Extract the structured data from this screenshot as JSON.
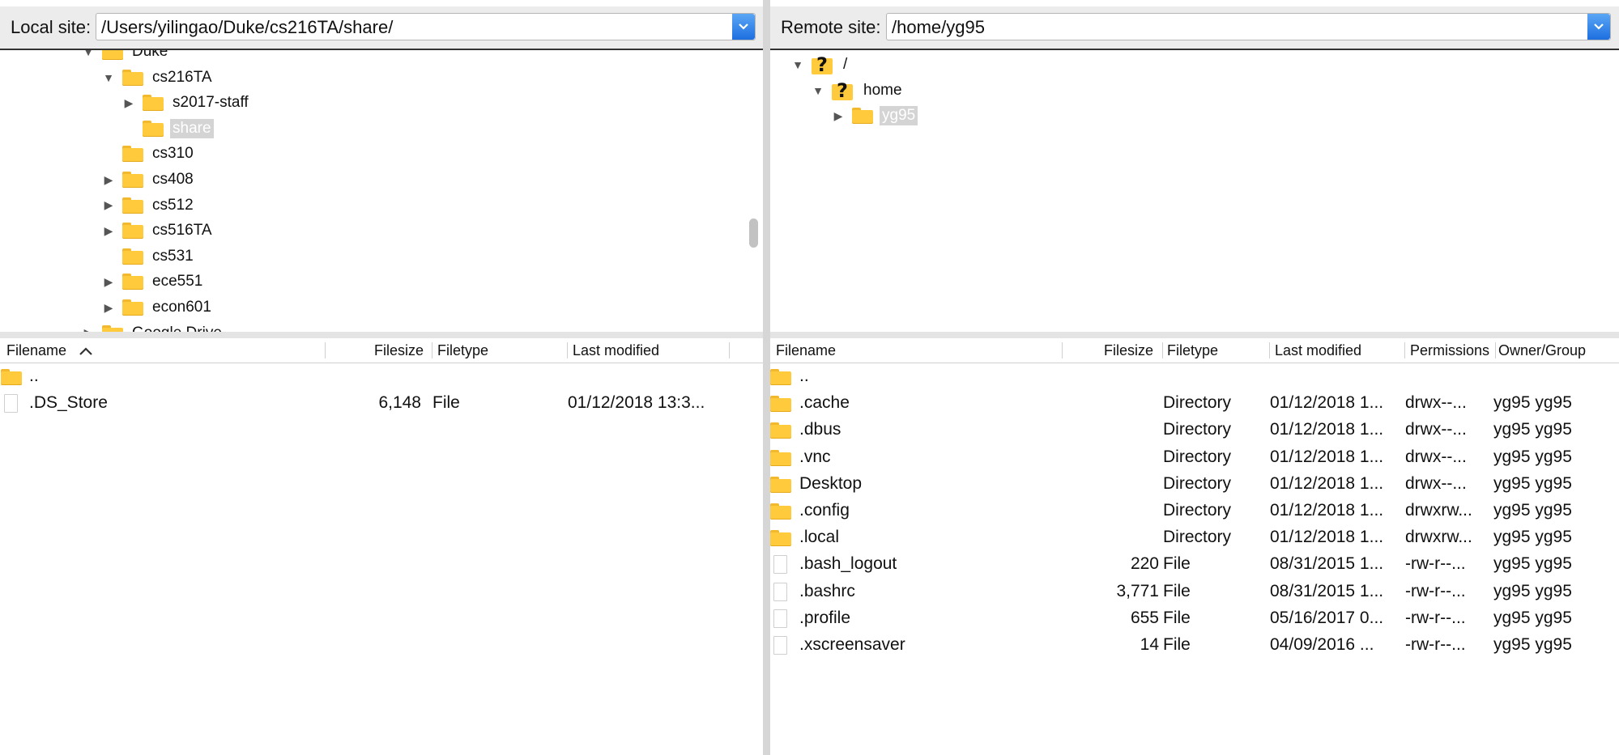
{
  "local": {
    "label": "Local site:",
    "path": "/Users/yilingao/Duke/cs216TA/share/",
    "tree": [
      {
        "name": "Duke",
        "indent": 1,
        "state": "expanded"
      },
      {
        "name": "cs216TA",
        "indent": 2,
        "state": "expanded"
      },
      {
        "name": "s2017-staff",
        "indent": 3,
        "state": "collapsed"
      },
      {
        "name": "share",
        "indent": 3,
        "state": "none",
        "selected": true
      },
      {
        "name": "cs310",
        "indent": 2,
        "state": "none"
      },
      {
        "name": "cs408",
        "indent": 2,
        "state": "collapsed"
      },
      {
        "name": "cs512",
        "indent": 2,
        "state": "collapsed"
      },
      {
        "name": "cs516TA",
        "indent": 2,
        "state": "collapsed"
      },
      {
        "name": "cs531",
        "indent": 2,
        "state": "none"
      },
      {
        "name": "ece551",
        "indent": 2,
        "state": "collapsed"
      },
      {
        "name": "econ601",
        "indent": 2,
        "state": "collapsed"
      },
      {
        "name": "Google Drive",
        "indent": 1,
        "state": "collapsed"
      }
    ],
    "columns": {
      "filename": "Filename",
      "filesize": "Filesize",
      "filetype": "Filetype",
      "last_modified": "Last modified"
    },
    "files": [
      {
        "name": "..",
        "size": "",
        "type": "",
        "modified": "",
        "kind": "folder"
      },
      {
        "name": ".DS_Store",
        "size": "6,148",
        "type": "File",
        "modified": "01/12/2018 13:3...",
        "kind": "file"
      }
    ]
  },
  "remote": {
    "label": "Remote site:",
    "path": "/home/yg95",
    "tree": [
      {
        "name": "/",
        "indent": 0,
        "state": "expanded",
        "icon": "question-folder"
      },
      {
        "name": "home",
        "indent": 1,
        "state": "expanded",
        "icon": "question-folder"
      },
      {
        "name": "yg95",
        "indent": 2,
        "state": "collapsed",
        "icon": "folder",
        "selected": true
      }
    ],
    "columns": {
      "filename": "Filename",
      "filesize": "Filesize",
      "filetype": "Filetype",
      "last_modified": "Last modified",
      "permissions": "Permissions",
      "owner_group": "Owner/Group"
    },
    "files": [
      {
        "name": "..",
        "size": "",
        "type": "",
        "modified": "",
        "permissions": "",
        "owner": "",
        "kind": "folder"
      },
      {
        "name": ".cache",
        "size": "",
        "type": "Directory",
        "modified": "01/12/2018 1...",
        "permissions": "drwx--...",
        "owner": "yg95 yg95",
        "kind": "folder"
      },
      {
        "name": ".dbus",
        "size": "",
        "type": "Directory",
        "modified": "01/12/2018 1...",
        "permissions": "drwx--...",
        "owner": "yg95 yg95",
        "kind": "folder"
      },
      {
        "name": ".vnc",
        "size": "",
        "type": "Directory",
        "modified": "01/12/2018 1...",
        "permissions": "drwx--...",
        "owner": "yg95 yg95",
        "kind": "folder"
      },
      {
        "name": "Desktop",
        "size": "",
        "type": "Directory",
        "modified": "01/12/2018 1...",
        "permissions": "drwx--...",
        "owner": "yg95 yg95",
        "kind": "folder"
      },
      {
        "name": ".config",
        "size": "",
        "type": "Directory",
        "modified": "01/12/2018 1...",
        "permissions": "drwxrw...",
        "owner": "yg95 yg95",
        "kind": "folder"
      },
      {
        "name": ".local",
        "size": "",
        "type": "Directory",
        "modified": "01/12/2018 1...",
        "permissions": "drwxrw...",
        "owner": "yg95 yg95",
        "kind": "folder"
      },
      {
        "name": ".bash_logout",
        "size": "220",
        "type": "File",
        "modified": "08/31/2015 1...",
        "permissions": "-rw-r--...",
        "owner": "yg95 yg95",
        "kind": "file"
      },
      {
        "name": ".bashrc",
        "size": "3,771",
        "type": "File",
        "modified": "08/31/2015 1...",
        "permissions": "-rw-r--...",
        "owner": "yg95 yg95",
        "kind": "file"
      },
      {
        "name": ".profile",
        "size": "655",
        "type": "File",
        "modified": "05/16/2017 0...",
        "permissions": "-rw-r--...",
        "owner": "yg95 yg95",
        "kind": "file"
      },
      {
        "name": ".xscreensaver",
        "size": "14",
        "type": "File",
        "modified": "04/09/2016 ...",
        "permissions": "-rw-r--...",
        "owner": "yg95 yg95",
        "kind": "file"
      }
    ]
  },
  "icons": {
    "folder": "folder-icon",
    "file": "file-icon",
    "question_folder": "unknown-folder-icon",
    "dropdown": "chevron-down-icon",
    "sort": "sort-ascending-icon"
  }
}
